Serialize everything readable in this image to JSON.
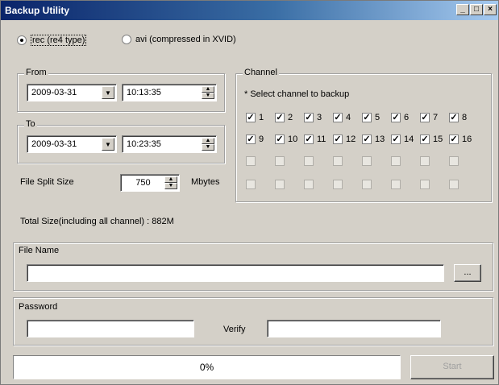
{
  "window": {
    "title": "Backup Utility"
  },
  "titlebar_buttons": {
    "minimize": "_",
    "maximize": "□",
    "close": "×"
  },
  "format": {
    "options": [
      {
        "label": "rec (re4 type)",
        "selected": true
      },
      {
        "label": "avi (compressed in XVID)",
        "selected": false
      }
    ]
  },
  "from": {
    "label": "From",
    "date": "2009-03-31",
    "time": "10:13:35"
  },
  "to": {
    "label": "To",
    "date": "2009-03-31",
    "time": "10:23:35"
  },
  "split": {
    "label": "File Split Size",
    "value": "750",
    "unit": "Mbytes"
  },
  "total_size": "Total Size(including all channel) : 882M",
  "channel": {
    "label": "Channel",
    "hint": "* Select channel to backup",
    "row1": [
      "1",
      "2",
      "3",
      "4",
      "5",
      "6",
      "7",
      "8"
    ],
    "row2": [
      "9",
      "10",
      "11",
      "12",
      "13",
      "14",
      "15",
      "16"
    ]
  },
  "file_name": {
    "label": "File Name",
    "value": "",
    "browse_label": "..."
  },
  "password": {
    "label": "Password",
    "verify_label": "Verify",
    "value": "",
    "verify_value": ""
  },
  "progress": {
    "value": 0,
    "text": "0%"
  },
  "start_button": {
    "label": "Start",
    "enabled": false
  },
  "colors": {
    "title_gradient_start": "#0a246a",
    "title_gradient_end": "#a6caf0",
    "face": "#d4d0c8"
  }
}
